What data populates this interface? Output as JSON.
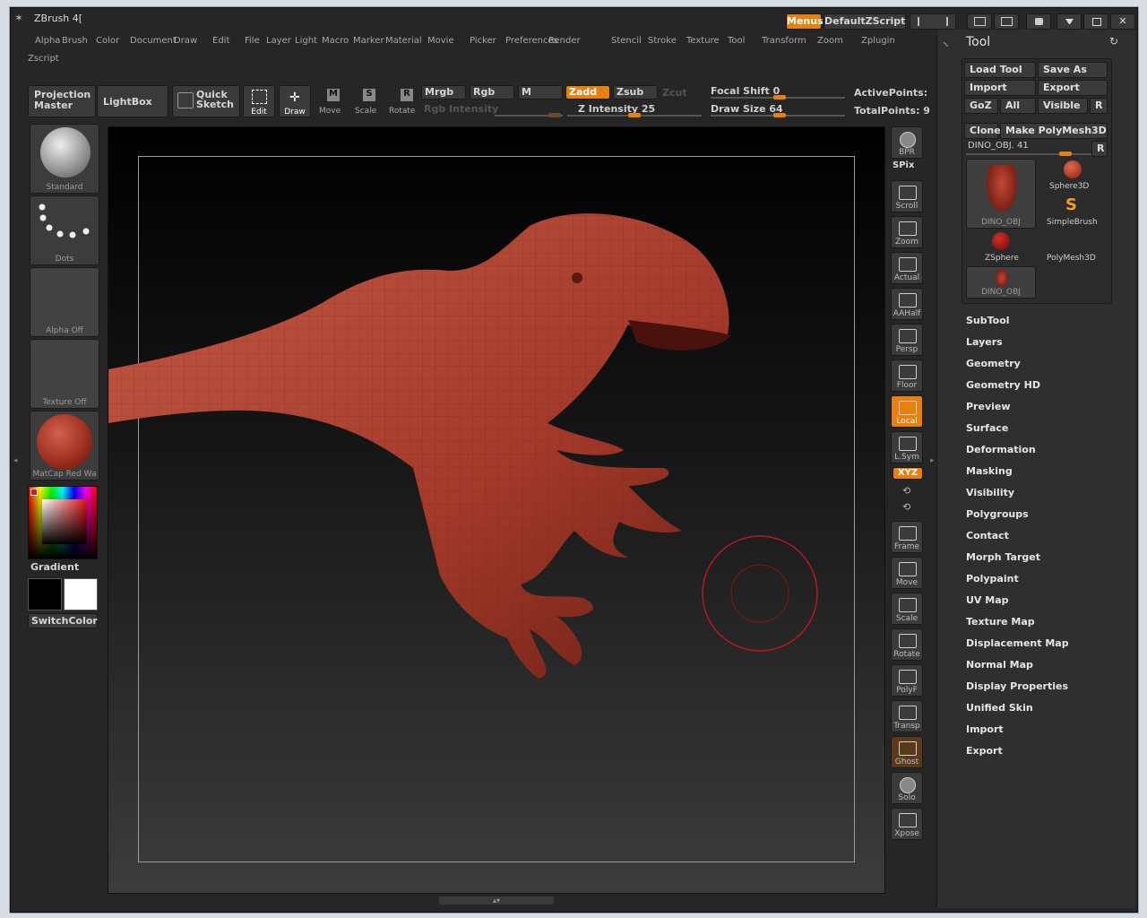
{
  "app": {
    "title": "ZBrush 4["
  },
  "titlebar": {
    "menus_label": "Menus",
    "script_label": "DefaultZScript"
  },
  "menubar": [
    "Alpha",
    "Brush",
    "Color",
    "Document",
    "Draw",
    "Edit",
    "File",
    "Layer",
    "Light",
    "Macro",
    "Marker",
    "Material",
    "Movie",
    "Picker",
    "Preferences",
    "Render",
    "Stencil",
    "Stroke",
    "Texture",
    "Tool",
    "Transform",
    "Zoom",
    "Zplugin",
    "Zscript"
  ],
  "toolbar": {
    "projection_master": "Projection Master",
    "lightbox": "LightBox",
    "quick_sketch": "Quick Sketch",
    "modes": [
      {
        "label": "Edit",
        "active": true
      },
      {
        "label": "Draw",
        "active": true
      },
      {
        "label": "Move",
        "active": false
      },
      {
        "label": "Scale",
        "active": false
      },
      {
        "label": "Rotate",
        "active": false
      }
    ],
    "mrgb": "Mrgb",
    "rgb": "Rgb",
    "m": "M",
    "zadd": "Zadd",
    "zsub": "Zsub",
    "zcut": "Zcut",
    "rgb_intensity": "Rgb Intensity",
    "z_intensity": "Z Intensity 25",
    "focal_shift": "Focal Shift 0",
    "draw_size": "Draw Size 64",
    "active_points": "ActivePoints:",
    "total_points": "TotalPoints: 9"
  },
  "left_shelf": {
    "brush": "Standard",
    "stroke": "Dots",
    "alpha": "Alpha Off",
    "texture": "Texture Off",
    "material": "MatCap Red Wa",
    "gradient": "Gradient",
    "switch_color": "SwitchColor"
  },
  "right_rail": [
    {
      "label": "BPR"
    },
    {
      "label": "SPix"
    },
    {
      "label": "Scroll"
    },
    {
      "label": "Zoom"
    },
    {
      "label": "Actual"
    },
    {
      "label": "AAHalf"
    },
    {
      "label": "Persp"
    },
    {
      "label": "Floor"
    },
    {
      "label": "Local",
      "active": true
    },
    {
      "label": "L.Sym"
    },
    {
      "label": "XYZ",
      "active": true
    },
    {
      "label": "Frame"
    },
    {
      "label": "Move"
    },
    {
      "label": "Scale"
    },
    {
      "label": "Rotate"
    },
    {
      "label": "PolyF"
    },
    {
      "label": "Transp"
    },
    {
      "label": "Ghost"
    },
    {
      "label": "Solo"
    },
    {
      "label": "Xpose"
    }
  ],
  "tool_panel": {
    "title": "Tool",
    "load_tool": "Load Tool",
    "save_as": "Save As",
    "import": "Import",
    "export": "Export",
    "goz": "GoZ",
    "all": "All",
    "visible": "Visible",
    "r": "R",
    "clone": "Clone",
    "make_polymesh": "Make PolyMesh3D",
    "current": "DINO_OBJ. 41",
    "thumbs": [
      "DINO_OBJ",
      "Sphere3D",
      "SimpleBrush",
      "ZSphere",
      "PolyMesh3D",
      "DINO_OBJ"
    ],
    "sections": [
      "SubTool",
      "Layers",
      "Geometry",
      "Geometry HD",
      "Preview",
      "Surface",
      "Deformation",
      "Masking",
      "Visibility",
      "Polygroups",
      "Contact",
      "Morph Target",
      "Polypaint",
      "UV Map",
      "Texture Map",
      "Displacement Map",
      "Normal Map",
      "Display Properties",
      "Unified Skin",
      "Import",
      "Export"
    ]
  },
  "colors": {
    "accent": "#e8800f",
    "model": "#a83e2c",
    "brush_cursor": "#c0181c"
  }
}
